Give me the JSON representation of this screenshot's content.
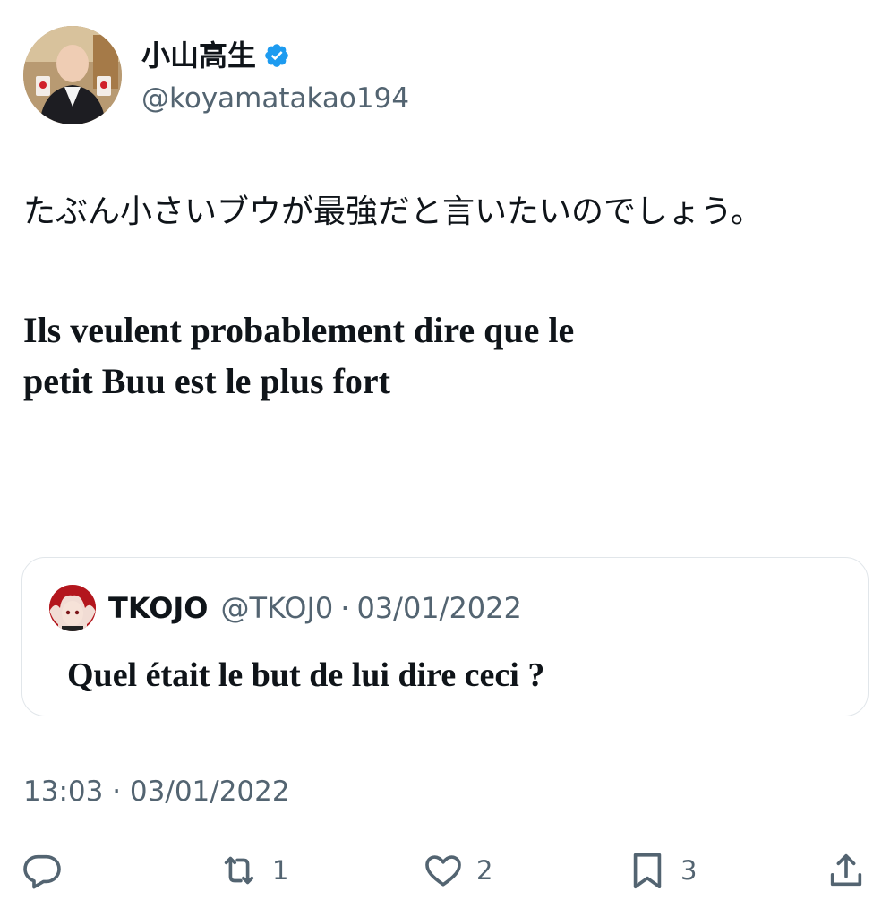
{
  "author": {
    "display_name": "小山高生",
    "handle": "@koyamatakao194",
    "verified": true,
    "verified_color": "#1d9bf0"
  },
  "tweet": {
    "text_ja": "たぶん小さいブウが最強だと言いたいのでしょう。",
    "text_fr_line1": "Ils veulent probablement dire que le",
    "text_fr_line2": "petit Buu est le plus fort"
  },
  "quote": {
    "display_name": "TKOJO",
    "handle": "@TKOJ0",
    "separator": "·",
    "date": "03/01/2022",
    "text": "Quel était le but de lui dire ceci ?"
  },
  "timestamp": {
    "time": "13:03",
    "separator": "·",
    "date": "03/01/2022"
  },
  "actions": {
    "reply_icon": "reply-icon",
    "retweet_icon": "retweet-icon",
    "retweet_count": "1",
    "like_icon": "heart-icon",
    "like_count": "2",
    "bookmark_icon": "bookmark-icon",
    "bookmark_count": "3",
    "share_icon": "share-icon"
  },
  "colors": {
    "text_primary": "#0f1419",
    "text_secondary": "#536471",
    "border": "#e1e6ea"
  }
}
